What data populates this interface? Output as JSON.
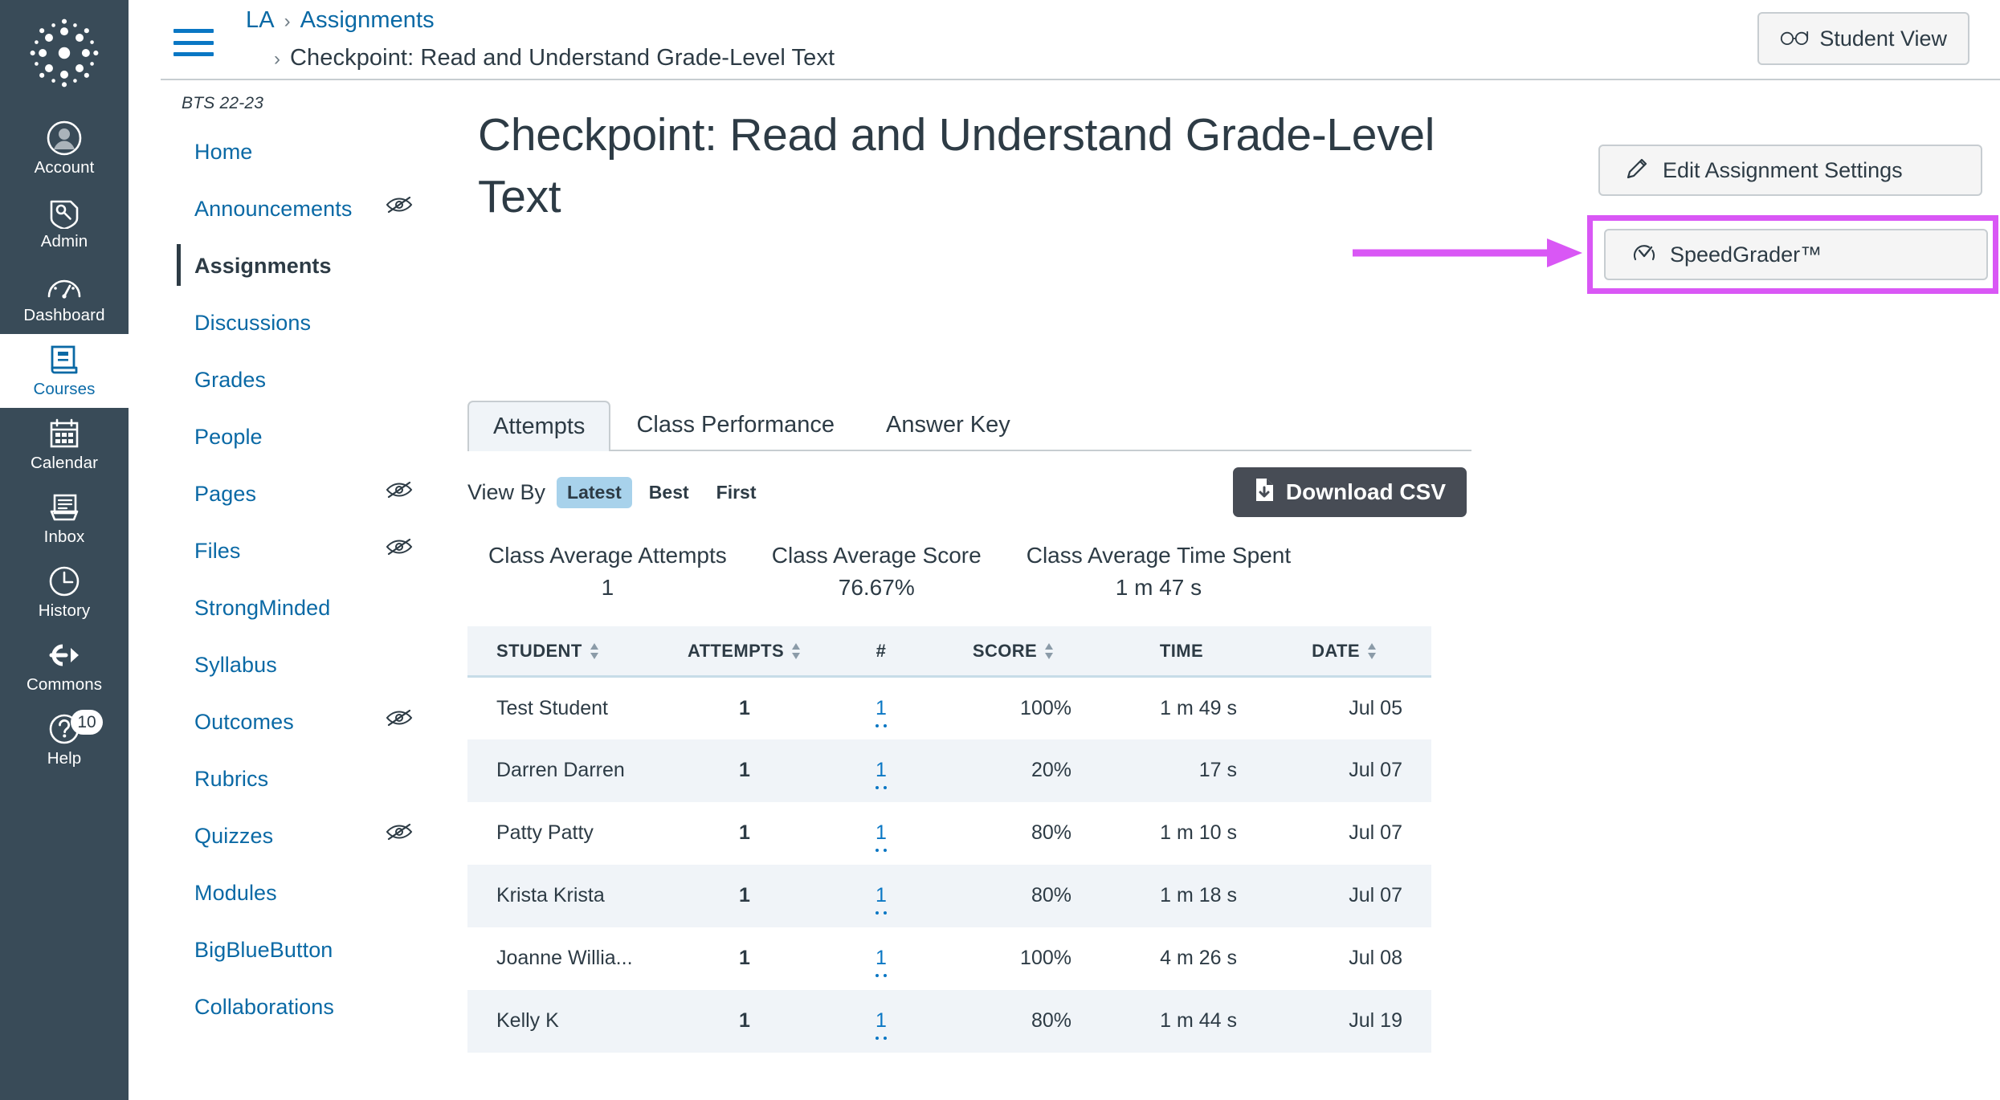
{
  "global_nav": {
    "logo": "canvas-logo",
    "items": [
      {
        "label": "Account",
        "icon": "account-avatar-icon",
        "active": false,
        "badge": null
      },
      {
        "label": "Admin",
        "icon": "shield-key-icon",
        "active": false,
        "badge": null
      },
      {
        "label": "Dashboard",
        "icon": "dashboard-gauge-icon",
        "active": false,
        "badge": null
      },
      {
        "label": "Courses",
        "icon": "book-icon",
        "active": true,
        "badge": null
      },
      {
        "label": "Calendar",
        "icon": "calendar-icon",
        "active": false,
        "badge": null
      },
      {
        "label": "Inbox",
        "icon": "inbox-tray-icon",
        "active": false,
        "badge": null
      },
      {
        "label": "History",
        "icon": "clock-icon",
        "active": false,
        "badge": null
      },
      {
        "label": "Commons",
        "icon": "commons-arrow-icon",
        "active": false,
        "badge": null
      },
      {
        "label": "Help",
        "icon": "question-circle-icon",
        "active": false,
        "badge": "10"
      }
    ]
  },
  "top_bar": {
    "menu_icon": "hamburger-icon",
    "breadcrumb": {
      "course": "LA",
      "section": "Assignments",
      "current": "Checkpoint: Read and Understand Grade-Level Text",
      "separator": "›"
    },
    "student_view_label": "Student View",
    "student_view_icon": "eyeglasses-icon"
  },
  "course_nav": {
    "term": "BTS 22-23",
    "items": [
      {
        "label": "Home",
        "active": false,
        "hidden_from_students": false
      },
      {
        "label": "Announcements",
        "active": false,
        "hidden_from_students": true
      },
      {
        "label": "Assignments",
        "active": true,
        "hidden_from_students": false
      },
      {
        "label": "Discussions",
        "active": false,
        "hidden_from_students": false
      },
      {
        "label": "Grades",
        "active": false,
        "hidden_from_students": false
      },
      {
        "label": "People",
        "active": false,
        "hidden_from_students": false
      },
      {
        "label": "Pages",
        "active": false,
        "hidden_from_students": true
      },
      {
        "label": "Files",
        "active": false,
        "hidden_from_students": true
      },
      {
        "label": "StrongMinded",
        "active": false,
        "hidden_from_students": false
      },
      {
        "label": "Syllabus",
        "active": false,
        "hidden_from_students": false
      },
      {
        "label": "Outcomes",
        "active": false,
        "hidden_from_students": true
      },
      {
        "label": "Rubrics",
        "active": false,
        "hidden_from_students": false
      },
      {
        "label": "Quizzes",
        "active": false,
        "hidden_from_students": true
      },
      {
        "label": "Modules",
        "active": false,
        "hidden_from_students": false
      },
      {
        "label": "BigBlueButton",
        "active": false,
        "hidden_from_students": false
      },
      {
        "label": "Collaborations",
        "active": false,
        "hidden_from_students": false
      }
    ]
  },
  "page": {
    "title": "Checkpoint: Read and Understand Grade-Level Text"
  },
  "actions": {
    "edit_label": "Edit Assignment Settings",
    "edit_icon": "pencil-icon",
    "speedgrader_label": "SpeedGrader™",
    "speedgrader_icon": "speedometer-icon",
    "highlight_color": "#D957F5",
    "annotation": "arrow-pointing-to-speedgrader"
  },
  "quiz_panel": {
    "tabs": [
      {
        "label": "Attempts",
        "active": true
      },
      {
        "label": "Class Performance",
        "active": false
      },
      {
        "label": "Answer Key",
        "active": false
      }
    ],
    "view_by": {
      "label": "View By",
      "options": [
        {
          "label": "Latest",
          "selected": true
        },
        {
          "label": "Best",
          "selected": false
        },
        {
          "label": "First",
          "selected": false
        }
      ]
    },
    "download_csv_label": "Download CSV",
    "download_csv_icon": "download-file-icon",
    "stats": [
      {
        "label": "Class Average Attempts",
        "value": "1"
      },
      {
        "label": "Class Average Score",
        "value": "76.67%"
      },
      {
        "label": "Class Average Time Spent",
        "value": "1 m 47 s"
      }
    ],
    "table": {
      "columns": [
        {
          "label": "STUDENT",
          "sortable": true
        },
        {
          "label": "ATTEMPTS",
          "sortable": true
        },
        {
          "label": "#",
          "sortable": false
        },
        {
          "label": "SCORE",
          "sortable": true
        },
        {
          "label": "TIME",
          "sortable": false
        },
        {
          "label": "DATE",
          "sortable": true
        }
      ],
      "rows": [
        {
          "student": "Test Student",
          "attempts": "1",
          "num": "1",
          "score": "100%",
          "time": "1 m 49 s",
          "date": "Jul 05"
        },
        {
          "student": "Darren Darren",
          "attempts": "1",
          "num": "1",
          "score": "20%",
          "time": "17 s",
          "date": "Jul 07"
        },
        {
          "student": "Patty Patty",
          "attempts": "1",
          "num": "1",
          "score": "80%",
          "time": "1 m 10 s",
          "date": "Jul 07"
        },
        {
          "student": "Krista Krista",
          "attempts": "1",
          "num": "1",
          "score": "80%",
          "time": "1 m 18 s",
          "date": "Jul 07"
        },
        {
          "student": "Joanne Willia...",
          "attempts": "1",
          "num": "1",
          "score": "100%",
          "time": "4 m 26 s",
          "date": "Jul 08"
        },
        {
          "student": "Kelly K",
          "attempts": "1",
          "num": "1",
          "score": "80%",
          "time": "1 m 44 s",
          "date": "Jul 19"
        }
      ]
    }
  }
}
